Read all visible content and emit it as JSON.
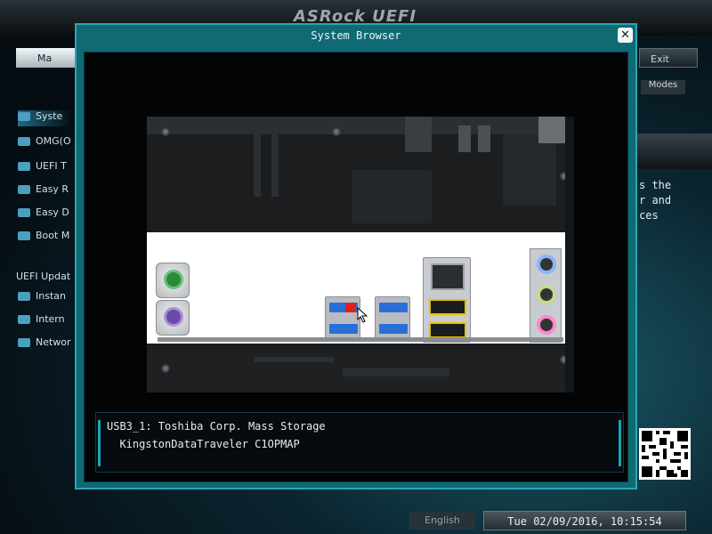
{
  "background": {
    "logo": "ASRock UEFI",
    "top_tab_label": "Ma",
    "exit_label": "Exit",
    "sub_right_label": "Modes",
    "sidebar_items": [
      {
        "label": "Syste",
        "icon": "system-icon",
        "active": true
      },
      {
        "label": "OMG(O",
        "icon": "omg-icon",
        "active": false
      },
      {
        "label": "UEFI T",
        "icon": "uefi-tech-icon",
        "active": false
      },
      {
        "label": "Easy R",
        "icon": "easy-raid-icon",
        "active": false
      },
      {
        "label": "Easy D",
        "icon": "easy-driver-icon",
        "active": false
      },
      {
        "label": "Boot M",
        "icon": "boot-icon",
        "active": false
      }
    ],
    "sidebar_heading": "UEFI Updat",
    "sidebar_items_2": [
      {
        "label": "Instan",
        "icon": "instant-flash-icon"
      },
      {
        "label": "Intern",
        "icon": "internet-flash-icon"
      },
      {
        "label": "Networ",
        "icon": "network-icon"
      }
    ],
    "description_text": [
      "s the",
      "r and",
      "ces"
    ],
    "language_button": "English",
    "datetime": "Tue 02/09/2016, 10:15:54"
  },
  "dialog": {
    "title": "System Browser",
    "close_symbol": "✕",
    "info": {
      "line1": "USB3_1: Toshiba Corp. Mass Storage",
      "line2": "  KingstonDataTraveler C1OPMAP"
    }
  },
  "colors": {
    "accent": "#2aa6b2",
    "dialog_bg": "#0f6a74",
    "usb3_blue": "#2a6fd8",
    "lan_badge": "#e8c000",
    "usb_badge_red": "#e02020",
    "jack_blue": "#8ab4ff",
    "jack_lime": "#c8d890",
    "jack_pink": "#ff88cc",
    "ps2_green": "#2a8a3a",
    "ps2_purple": "#6a4aa8"
  }
}
